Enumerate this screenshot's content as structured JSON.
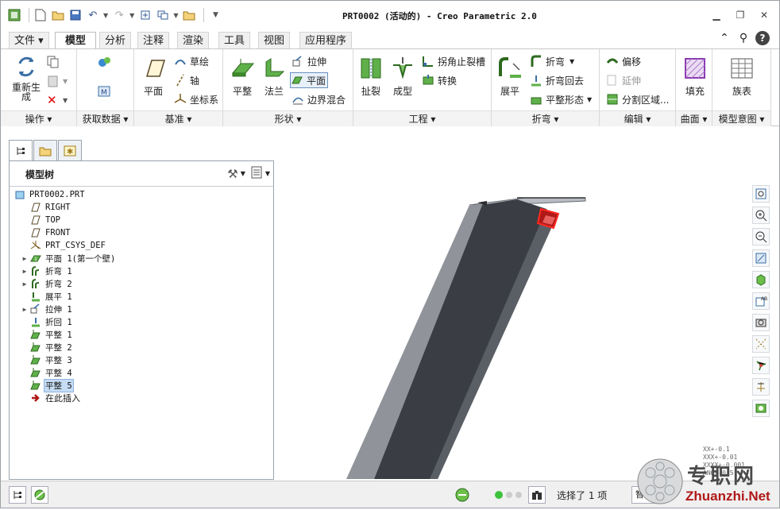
{
  "window": {
    "title": "PRT0002 (活动的) - Creo Parametric 2.0",
    "controls": [
      "minimize-icon",
      "restore-icon",
      "close-icon"
    ]
  },
  "quick_access": [
    "app-logo-icon",
    "new-icon",
    "open-icon",
    "save-icon",
    "undo-icon",
    "redo-icon",
    "regenerate-icon",
    "windows-icon",
    "close-window-icon",
    "customize-icon"
  ],
  "tabs": [
    {
      "label": "文件 ▾",
      "active": false
    },
    {
      "label": "模型",
      "active": true
    },
    {
      "label": "分析",
      "active": false
    },
    {
      "label": "注释",
      "active": false
    },
    {
      "label": "渲染",
      "active": false
    },
    {
      "label": "工具",
      "active": false
    },
    {
      "label": "视图",
      "active": false
    },
    {
      "label": "应用程序",
      "active": false
    }
  ],
  "ribbon": {
    "groups": {
      "operations": "操作 ▾",
      "get_data": "获取数据 ▾",
      "datum": "基准 ▾",
      "shapes": "形状 ▾",
      "engineering": "工程 ▾",
      "bends": "折弯 ▾",
      "editing": "编辑 ▾",
      "surfaces": "曲面 ▾",
      "model_intent": "模型意图 ▾"
    },
    "ops": {
      "regenerate": "重新生成"
    },
    "datum": {
      "plane": "平面",
      "sketch": "草绘",
      "axis": "轴",
      "csys": "坐标系"
    },
    "shapes": {
      "flat": "平整",
      "flange": "法兰",
      "extrude": "拉伸",
      "planar": "平面",
      "blend": "边界混合"
    },
    "eng": {
      "rip": "扯裂",
      "form": "成型",
      "corner_relief": "拐角止裂槽",
      "convert": "转换"
    },
    "bends": {
      "unbend": "展平",
      "bend": "折弯",
      "bend_back": "折弯回去",
      "flatten_form": "平整形态"
    },
    "edit": {
      "offset": "偏移",
      "extend": "延伸",
      "split_area": "分割区域..."
    },
    "surf": {
      "fill": "填充"
    },
    "intent": {
      "family_table": "族表"
    }
  },
  "model_tree": {
    "header": "模型树",
    "items": [
      {
        "label": "PRT0002.PRT",
        "icon": "part-icon",
        "expandable": false,
        "indent": 0
      },
      {
        "label": "RIGHT",
        "icon": "datum-plane-icon",
        "expandable": false,
        "indent": 1
      },
      {
        "label": "TOP",
        "icon": "datum-plane-icon",
        "expandable": false,
        "indent": 1
      },
      {
        "label": "FRONT",
        "icon": "datum-plane-icon",
        "expandable": false,
        "indent": 1
      },
      {
        "label": "PRT_CSYS_DEF",
        "icon": "csys-icon",
        "expandable": false,
        "indent": 1
      },
      {
        "label": "平面 1(第一个壁)",
        "icon": "flat-wall-icon",
        "expandable": true,
        "indent": 1
      },
      {
        "label": "折弯 1",
        "icon": "bend-icon",
        "expandable": true,
        "indent": 1
      },
      {
        "label": "折弯 2",
        "icon": "bend-icon",
        "expandable": true,
        "indent": 1
      },
      {
        "label": "展平 1",
        "icon": "unbend-icon",
        "expandable": false,
        "indent": 1
      },
      {
        "label": "拉伸 1",
        "icon": "extrude-icon",
        "expandable": true,
        "indent": 1
      },
      {
        "label": "折回 1",
        "icon": "bend-back-icon",
        "expandable": false,
        "indent": 1
      },
      {
        "label": "平整 1",
        "icon": "flat-icon",
        "expandable": false,
        "indent": 1
      },
      {
        "label": "平整 2",
        "icon": "flat-icon",
        "expandable": false,
        "indent": 1
      },
      {
        "label": "平整 3",
        "icon": "flat-icon",
        "expandable": false,
        "indent": 1
      },
      {
        "label": "平整 4",
        "icon": "flat-icon",
        "expandable": false,
        "indent": 1
      },
      {
        "label": "平整 5",
        "icon": "flat-icon",
        "expandable": false,
        "indent": 1,
        "selected": true
      },
      {
        "label": "在此插入",
        "icon": "insert-here-icon",
        "expandable": false,
        "indent": 1
      }
    ]
  },
  "status": {
    "selection": "选择了 1 项",
    "filter": "智"
  },
  "tolerance": [
    "XX+-0.1",
    "XXX+-0.01",
    "XXXX+-0.001",
    "ANG+-0.5"
  ],
  "watermark": {
    "cn": "专职网",
    "url": "Zhuanzhi.Net"
  },
  "colors": {
    "accent": "#3a6ea5",
    "selected": "#c6dcf3",
    "part": "#4a4f56",
    "highlight": "#e0201a"
  }
}
